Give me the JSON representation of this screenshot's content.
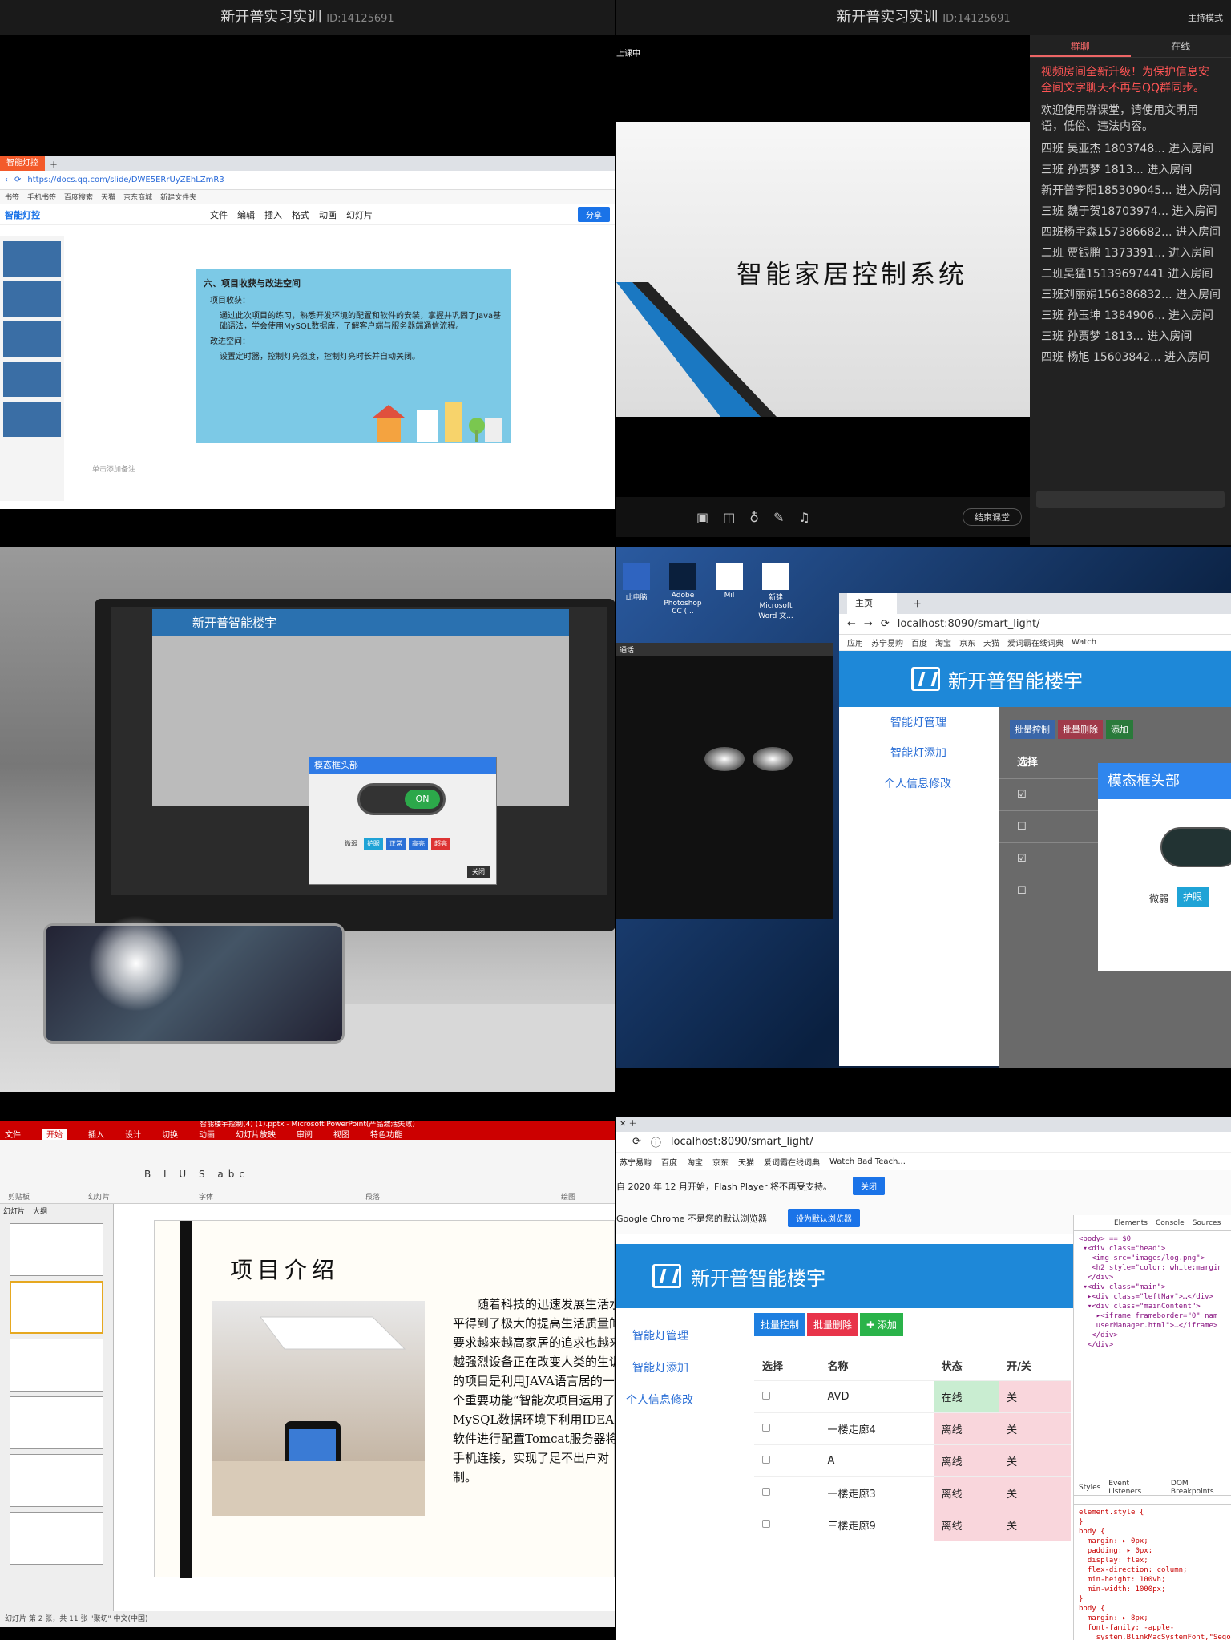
{
  "stream_title": "新开普实习实训",
  "room_id": "ID:14125691",
  "q1": {
    "tab_label": "智能灯控",
    "url": "https://docs.qq.com/slide/DWE5ERrUyZEhLZmR3",
    "app_name": "智能灯控",
    "menu": [
      "文件",
      "编辑",
      "插入",
      "格式",
      "动画",
      "幻灯片"
    ],
    "share_label": "分享",
    "slide_heading": "六、项目收获与改进空间",
    "harvest_label": "项目收获：",
    "harvest_text": "通过此次项目的练习，熟悉开发环境的配置和软件的安装，掌握并巩固了Java基础语法，学会使用MySQL数据库，了解客户端与服务器端通信流程。",
    "improve_label": "改进空间：",
    "improve_text": "设置定时器，控制灯亮强度，控制灯亮时长并自动关闭。",
    "note_placeholder": "单击添加备注"
  },
  "q2": {
    "host_mode": "主持模式",
    "class_label": "上课中",
    "slide_title": "智能家居控制系统",
    "chat_tabs": [
      "群聊",
      "在线"
    ],
    "notice": "视频房间全新升级！为保护信息安全间文字聊天不再与QQ群同步。",
    "system_msg": "欢迎使用群课堂，请使用文明用语，低俗、违法内容。",
    "messages": [
      "四班 吴亚杰 1803748... 进入房间",
      "三班  孙贾梦   1813... 进入房间",
      "新开普李阳185309045... 进入房间",
      "三班 魏于贺18703974... 进入房间",
      "四班杨宇森157386682... 进入房间",
      "二班 贾银鹏 1373391... 进入房间",
      "二班吴猛15139697441 进入房间",
      "三班刘丽娟156386832... 进入房间",
      "三班 孙玉坤 1384906... 进入房间",
      "三班  孙贾梦   1813... 进入房间",
      "四班 杨旭 15603842... 进入房间"
    ],
    "end_label": "结束课堂"
  },
  "q3": {
    "app_title": "新开普智能楼宇",
    "modal_title": "模态框头部",
    "toggle_label": "ON",
    "buttons": [
      "微弱",
      "护眼",
      "正常",
      "高亮",
      "超亮"
    ],
    "close_label": "关闭"
  },
  "q4": {
    "desktop_icons": [
      "此电脑",
      "Adobe Photoshop CC (...",
      "Mil",
      "新建 Microsoft Word 文..."
    ],
    "call_label": "通话",
    "tab_label": "主页",
    "url": "localhost:8090/smart_light/",
    "bookmarks": [
      "应用",
      "苏宁易购",
      "百度",
      "淘宝",
      "京东",
      "天猫",
      "爱词霸在线词典",
      "Watch"
    ],
    "app_title": "新开普智能楼宇",
    "nav": [
      "智能灯管理",
      "智能灯添加",
      "个人信息修改"
    ],
    "buttons": [
      "批量控制",
      "批量删除",
      "添加"
    ],
    "col_select": "选择",
    "modal_title": "模态框头部",
    "modal_buttons": [
      "微弱",
      "护眼"
    ]
  },
  "q5": {
    "window_title": "智能楼宇控制(4) (1).pptx - Microsoft PowerPoint(产品激活失败)",
    "ribbon_tabs": [
      "文件",
      "开始",
      "插入",
      "设计",
      "切换",
      "动画",
      "幻灯片放映",
      "审阅",
      "视图",
      "特色功能"
    ],
    "ribbon_groups": [
      "剪贴板",
      "幻灯片",
      "字体",
      "段落",
      "绘图"
    ],
    "panel_tabs": [
      "幻灯片",
      "大纲"
    ],
    "slide_heading": "项目介绍",
    "slide_body": "随着科技的迅速发展生活水平得到了极大的提高生活质量的要求越来越高家居的追求也越来越强烈设备正在改变人类的生训的项目是利用JAVA语言居的一个重要功能“智能次项目运用了MySQL数据环境下利用IDEA软件进行配置Tomcat服务器将手机连接，实现了足不出户对制。",
    "status": "幻灯片 第 2 张，共 11 张    \"聚切\"    中文(中国)"
  },
  "q6": {
    "url": "localhost:8090/smart_light/",
    "bookmarks": [
      "苏宁易购",
      "百度",
      "淘宝",
      "京东",
      "天猫",
      "爱词霸在线词典",
      "Watch Bad Teach..."
    ],
    "flash_notice": "自 2020 年 12 月开始，Flash Player 将不再受支持。",
    "flash_close": "关闭",
    "default_notice": "Google Chrome 不是您的默认浏览器",
    "default_btn": "设为默认浏览器",
    "app_title": "新开普智能楼宇",
    "nav": [
      "智能灯管理",
      "智能灯添加",
      "个人信息修改"
    ],
    "buttons": [
      "批量控制",
      "批量删除",
      "✚ 添加"
    ],
    "columns": [
      "选择",
      "名称",
      "状态",
      "开/关"
    ],
    "rows": [
      {
        "name": "AVD",
        "status": "在线",
        "switch": "关"
      },
      {
        "name": "一楼走廊4",
        "status": "离线",
        "switch": "关"
      },
      {
        "name": "A",
        "status": "离线",
        "switch": "关"
      },
      {
        "name": "一楼走廊3",
        "status": "离线",
        "switch": "关"
      },
      {
        "name": "三楼走廊9",
        "status": "离线",
        "switch": "关"
      }
    ],
    "devtools_tabs": [
      "Elements",
      "Console",
      "Sources"
    ],
    "devtools_subtabs": [
      "Styles",
      "Event Listeners",
      "DOM Breakpoints"
    ],
    "html_code": "<body> == $0\n ▾<div class=\"head\">\n   <img src=\"images/log.png\">\n   <h2 style=\"color: white;margin\n  </div>\n ▾<div class=\"main\">\n  ▸<div class=\"leftNav\">…</div>\n  ▾<div class=\"mainContent\">\n    ▸<iframe frameborder=\"0\" nam\n    userManager.html\">…</iframe>\n   </div>\n  </div>",
    "styles_code": "element.style {\n}\nbody {\n  margin: ▸ 0px;\n  padding: ▸ 0px;\n  display: flex;\n  flex-direction: column;\n  min-height: 100vh;\n  min-width: 1000px;\n}\nbody {\n  margin: ▸ 8px;\n  font-family: -apple-\n    system,BlinkMacSystemFont,\"Sego"
  }
}
